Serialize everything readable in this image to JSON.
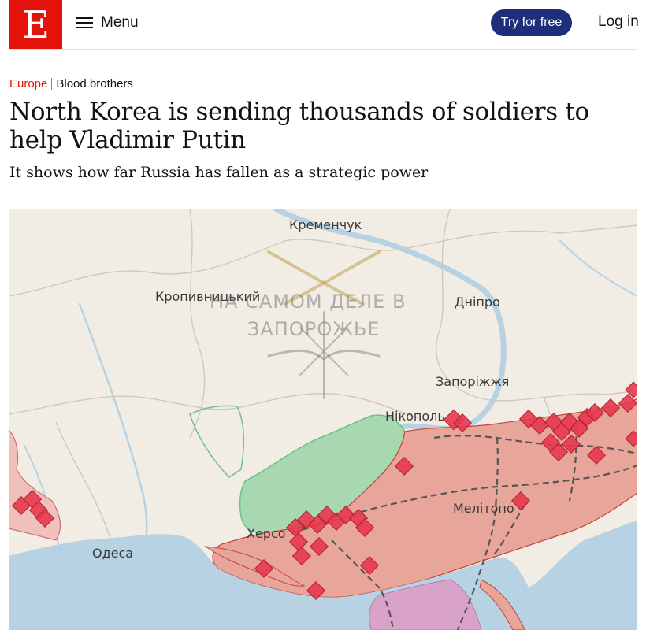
{
  "header": {
    "logo_letter": "E",
    "menu_label": "Menu",
    "cta_label": "Try for free",
    "login_label": "Log in"
  },
  "article": {
    "section": "Europe",
    "flytitle": "Blood brothers",
    "headline": "North Korea is sending thousands of soldiers to help Vladimir Putin",
    "subheadline": "It shows how far Russia has fallen as a strategic power"
  },
  "map": {
    "cities": {
      "kremenchuk": "Кременчук",
      "kropyvnytskyi": "Кропивницький",
      "dnipro": "Дніпро",
      "zaporizhzhia": "Запоріжжя",
      "nikopol": "Нікополь",
      "melitopol": "Мелітопо",
      "kherson": "Херсо",
      "odesa": "Одеса"
    },
    "watermark": {
      "line1": "НА САМОМ ДЕЛЕ В",
      "line2": "ЗАПОРОЖЬЕ"
    },
    "colors": {
      "occupied": "#e8a59a",
      "liberated": "#a8d8b0",
      "water": "#b7d2e3",
      "land": "#f2ede4",
      "marker": "#e8394c"
    }
  }
}
